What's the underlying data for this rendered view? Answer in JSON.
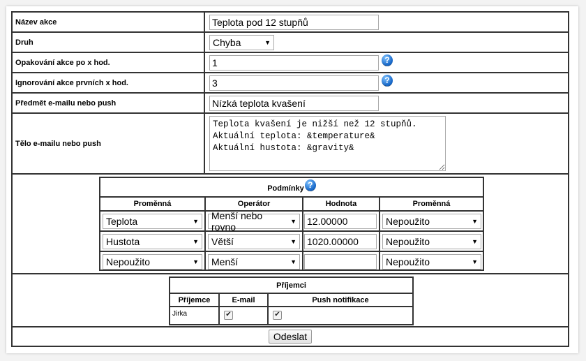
{
  "fields": {
    "name": {
      "label": "Název akce",
      "value": "Teplota pod 12 stupňů"
    },
    "type": {
      "label": "Druh",
      "value": "Chyba"
    },
    "repeat": {
      "label": "Opakování akce po x hod.",
      "value": "1"
    },
    "ignore": {
      "label": "Ignorování akce prvních x hod.",
      "value": "3"
    },
    "subject": {
      "label": "Předmět e-mailu nebo push",
      "value": "Nízká teplota kvašení"
    },
    "body": {
      "label": "Tělo e-mailu nebo push",
      "value": "Teplota kvašení je nižší než 12 stupňů.\nAktuální teplota: &temperature&\nAktuální hustota: &gravity&"
    }
  },
  "conditions": {
    "title": "Podmínky",
    "headers": [
      "Proměnná",
      "Operátor",
      "Hodnota",
      "Proměnná"
    ],
    "rows": [
      {
        "variable": "Teplota",
        "operator": "Menší nebo rovno",
        "value": "12.00000",
        "variable2": "Nepoužito"
      },
      {
        "variable": "Hustota",
        "operator": "Větší",
        "value": "1020.00000",
        "variable2": "Nepoužito"
      },
      {
        "variable": "Nepoužito",
        "operator": "Menší",
        "value": "",
        "variable2": "Nepoužito"
      }
    ]
  },
  "recipients": {
    "title": "Příjemci",
    "headers": [
      "Příjemce",
      "E-mail",
      "Push notifikace"
    ],
    "rows": [
      {
        "name": "Jirka",
        "email": true,
        "push": true
      }
    ]
  },
  "submit_label": "Odeslat",
  "icons": {
    "help": "help-icon",
    "dropdown": "chevron-down-icon",
    "check": "checkmark-icon"
  },
  "colors": {
    "border": "#333333",
    "help_icon": "#1566c7",
    "background": "#f3f3f3"
  }
}
